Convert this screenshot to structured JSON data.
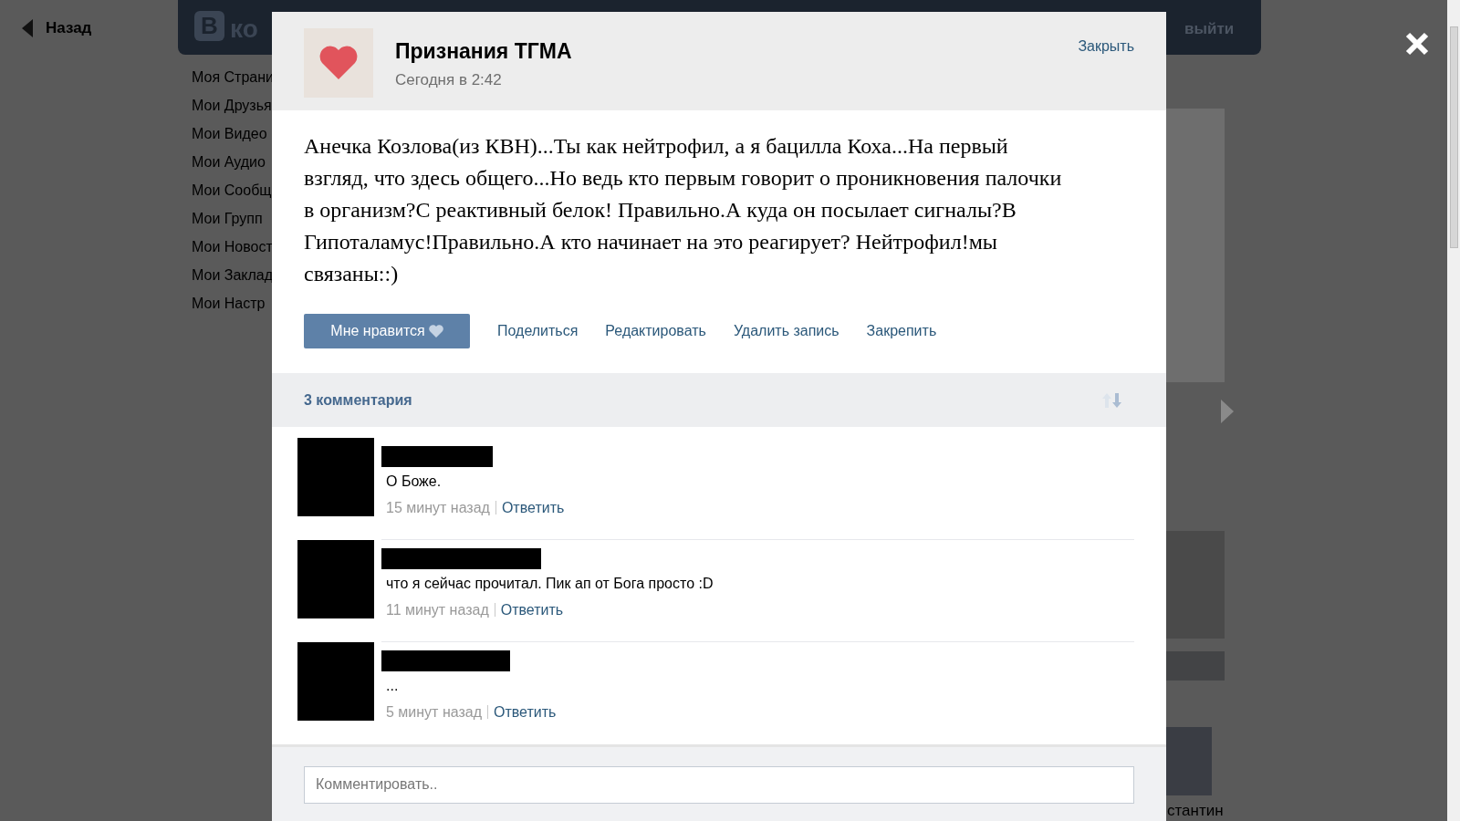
{
  "back_link": "Назад",
  "site_header": {
    "logo_letter": "В",
    "logo_text": "ко",
    "logout": "выйти"
  },
  "sidebar": {
    "items": [
      "Моя Страни",
      "Мои Друзья",
      "Мои Видео",
      "Мои Аудио",
      "Мои Сообщ",
      "Мои Групп",
      "Мои Новост",
      "Мои Заклад",
      "Мои Настр"
    ]
  },
  "background": {
    "friend_name_fragment": "стантин"
  },
  "post": {
    "author": "Признания ТГМА",
    "time": "Сегодня в 2:42",
    "close": "Закрыть",
    "text": "Анечка Козлова(из КВН)...Ты как нейтрофил, а я бацилла Коха...На первый взгляд, что здесь общего...Но ведь кто первым говорит о проникновения палочки в организм?С реактивный белок! Правильно.А куда он посылает сигналы?В Гипоталамус!Правильно.А кто начинает на это реагирует? Нейтрофил!мы связаны::)",
    "like_button": "Мне нравится",
    "actions": [
      "Поделиться",
      "Редактировать",
      "Удалить запись",
      "Закрепить"
    ],
    "comments_header": "3 комментария",
    "comments": [
      {
        "text": "О Боже.",
        "time": "15 минут назад",
        "reply": "Ответить"
      },
      {
        "text": "что я сейчас прочитал. Пик ап от Бога просто :D",
        "time": "11 минут назад",
        "reply": "Ответить"
      },
      {
        "text": "...",
        "time": "5 минут назад",
        "reply": "Ответить"
      }
    ],
    "comment_field": {
      "placeholder": "Комментировать.."
    }
  }
}
